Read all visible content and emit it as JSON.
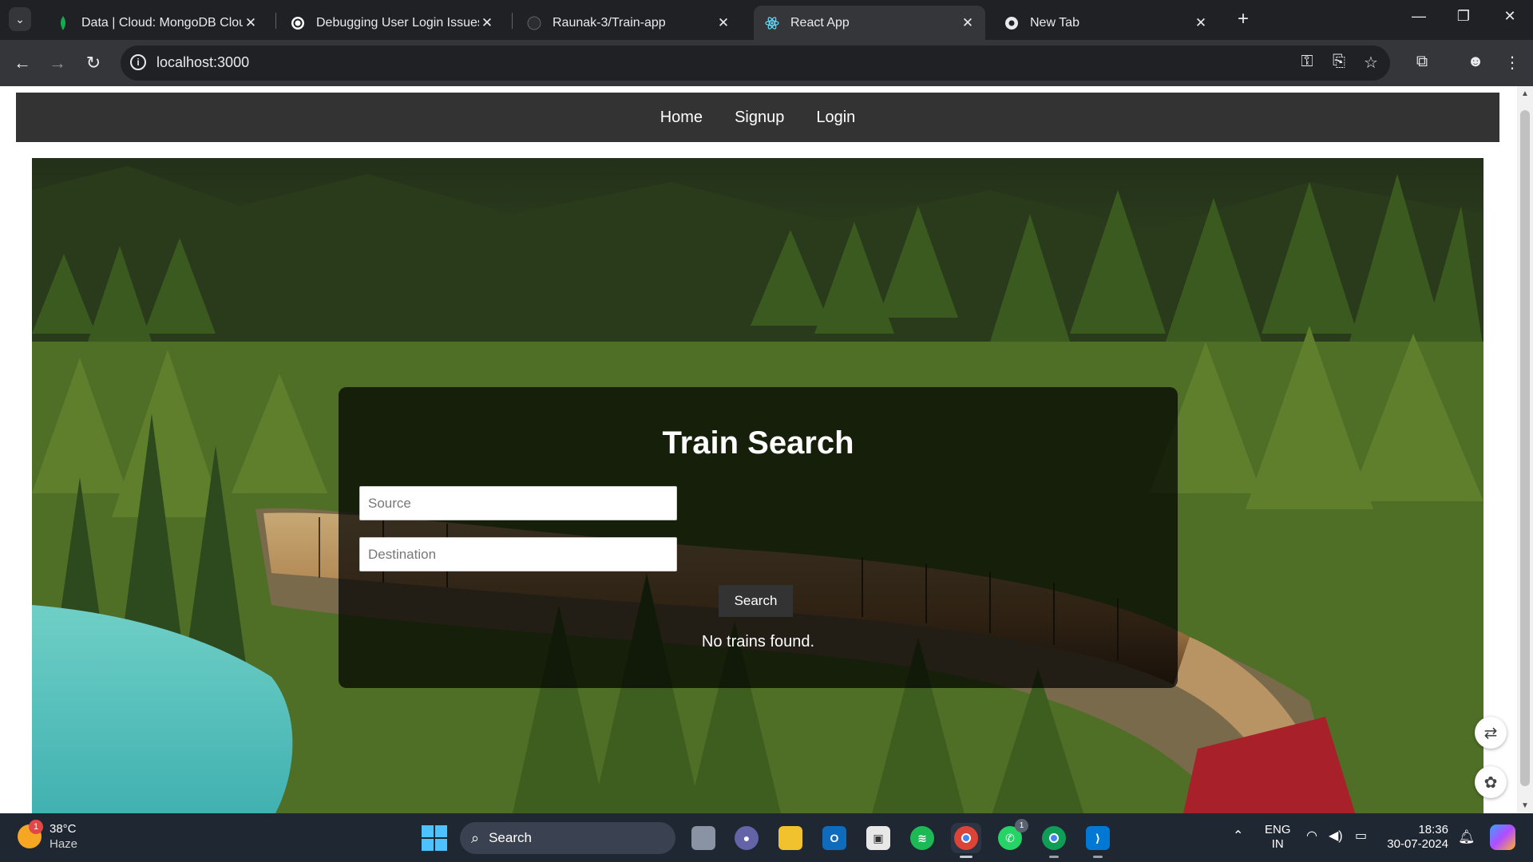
{
  "browser": {
    "tabs": [
      {
        "title": "Data | Cloud: MongoDB Cloud",
        "icon": "mongodb-leaf-icon",
        "active": false
      },
      {
        "title": "Debugging User Login Issues",
        "icon": "openai-icon",
        "active": false
      },
      {
        "title": "Raunak-3/Train-app",
        "icon": "github-icon",
        "active": false
      },
      {
        "title": "React App",
        "icon": "react-icon",
        "active": true
      },
      {
        "title": "New Tab",
        "icon": "chrome-icon",
        "active": false
      }
    ],
    "url": "localhost:3000"
  },
  "site": {
    "nav": {
      "home": "Home",
      "signup": "Signup",
      "login": "Login"
    },
    "search": {
      "title": "Train Search",
      "source_placeholder": "Source",
      "destination_placeholder": "Destination",
      "button": "Search",
      "result": "No trains found."
    }
  },
  "taskbar": {
    "weather": {
      "temp": "38°C",
      "condition": "Haze",
      "badge": "1"
    },
    "search_label": "Search",
    "whatsapp_badge": "1",
    "language": {
      "line1": "ENG",
      "line2": "IN"
    },
    "clock": {
      "time": "18:36",
      "date": "30-07-2024"
    }
  },
  "colors": {
    "nav_bg": "#333333",
    "panel_bg": "rgba(0,0,0,0.72)",
    "taskbar_bg": "#1f2733"
  }
}
